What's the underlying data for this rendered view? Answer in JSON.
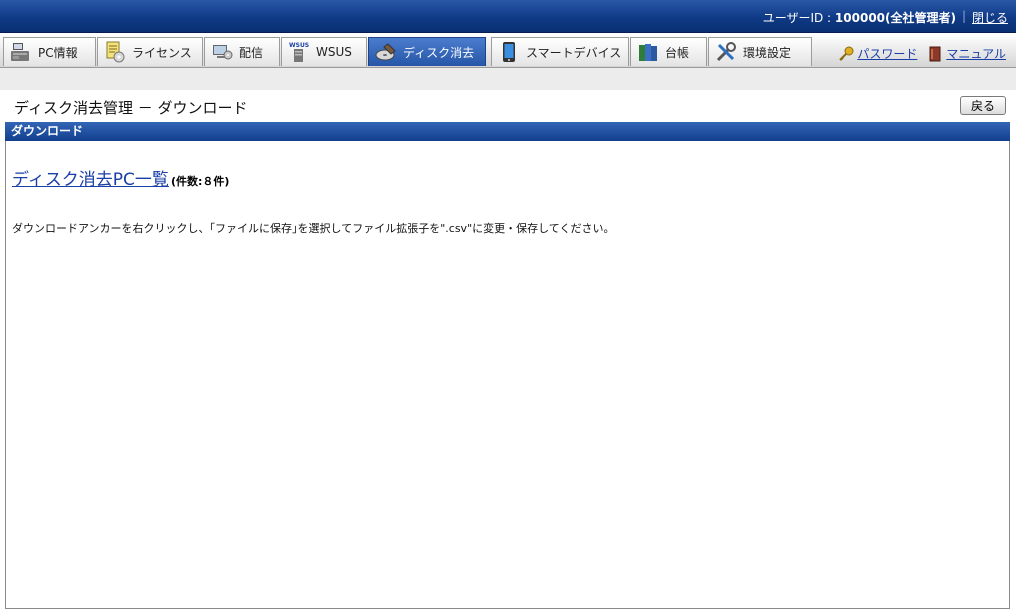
{
  "header": {
    "user_label": "ユーザーID : ",
    "user_value": "100000(全社管理者)",
    "separator": "|",
    "close_label": "閉じる"
  },
  "tabs": [
    {
      "label": "PC情報",
      "icon": "pc-info-icon"
    },
    {
      "label": "ライセンス",
      "icon": "license-icon"
    },
    {
      "label": "配信",
      "icon": "distribution-icon"
    },
    {
      "label": "WSUS",
      "icon": "wsus-server-icon"
    },
    {
      "label": "ディスク消去",
      "icon": "disk-erase-icon"
    },
    {
      "label": "スマートデバイス",
      "icon": "smart-device-icon"
    },
    {
      "label": "台帳",
      "icon": "ledger-icon"
    },
    {
      "label": "環境設定",
      "icon": "tools-icon"
    }
  ],
  "active_tab": "ディスク消去",
  "right_links": {
    "password_label": "パスワード",
    "manual_label": "マニュアル"
  },
  "page": {
    "title": "ディスク消去管理 － ダウンロード",
    "back_label": "戻る"
  },
  "section": {
    "title": "ダウンロード",
    "link_label": "ディスク消去PC一覧",
    "count_label": "(件数:８件)",
    "note": "ダウンロードアンカーを右クリックし、｢ファイルに保存｣を選択してファイル拡張子を\".csv\"に変更・保存してください。"
  },
  "colors": {
    "topbar": "#0f3a86",
    "active_tab": "#2556a8",
    "link": "#1a3fa6"
  }
}
